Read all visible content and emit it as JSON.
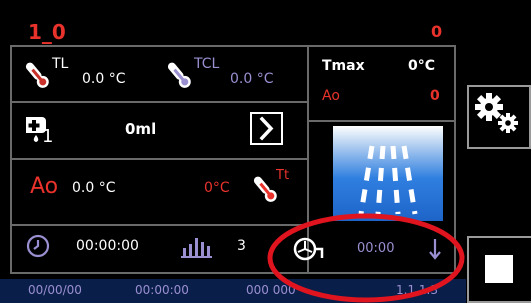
{
  "header": {
    "program_name": "1_0",
    "counter": "0"
  },
  "temps": {
    "tl_label": "TL",
    "tl_value": "0.0 °C",
    "tcl_label": "TCL",
    "tcl_value": "0.0 °C"
  },
  "tmax_panel": {
    "tmax_label": "Tmax",
    "tmax_value": "0°C",
    "ao_label": "Ao",
    "ao_value": "0"
  },
  "dosing": {
    "index": "1",
    "volume": "0ml"
  },
  "ao_row": {
    "ao_label": "Ao",
    "ao_temp": "0.0 °C",
    "target_temp": "0°C",
    "tt_label": "Tt"
  },
  "status_row": {
    "timer": "00:00:00",
    "cycles": "3",
    "pump_time": "00:00"
  },
  "footer": {
    "date": "00/00/00",
    "time": "00:00:00",
    "misc": "000 000",
    "version": "1.1.1.3"
  },
  "colors": {
    "accent_red": "#e8322b",
    "lavender": "#9a8fd0",
    "spray_blue": "#2f7fe0",
    "frame_gray": "#6a6a6a",
    "highlight_ellipse": "#e0141e"
  }
}
